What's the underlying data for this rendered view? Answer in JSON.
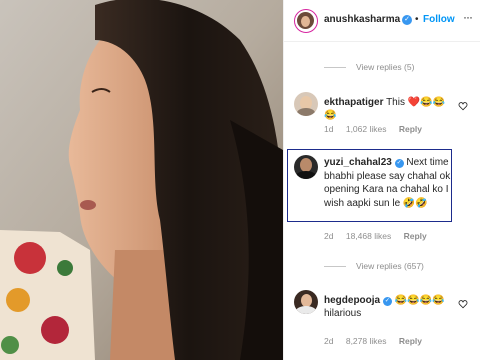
{
  "post": {
    "author": "anushkasharma",
    "follow_label": "Follow",
    "dot": "•"
  },
  "comments": [
    {
      "type": "view_replies",
      "label": "View replies (5)"
    },
    {
      "type": "comment",
      "username": "ekthapatiger",
      "text": "This ❤️😂😂😂",
      "time": "1d",
      "likes": "1,062 likes",
      "reply": "Reply"
    },
    {
      "type": "comment",
      "username": "yuzi_chahal23",
      "verified": true,
      "text": "Next time bhabhi please say chahal ok opening Kara na chahal ko I wish aapki sun le 🤣🤣",
      "time": "2d",
      "likes": "18,468 likes",
      "reply": "Reply"
    },
    {
      "type": "view_replies",
      "label": "View replies (657)"
    },
    {
      "type": "comment",
      "username": "hegdepooja",
      "verified": true,
      "text": "😂😂😂😂",
      "body2": "hilarious",
      "time": "2d",
      "likes": "8,278 likes",
      "reply": "Reply"
    }
  ],
  "colors": {
    "link_blue": "#0095f6",
    "highlight": "#1d2c8c",
    "verified": "#3897f0",
    "heart": "#ed4956"
  }
}
